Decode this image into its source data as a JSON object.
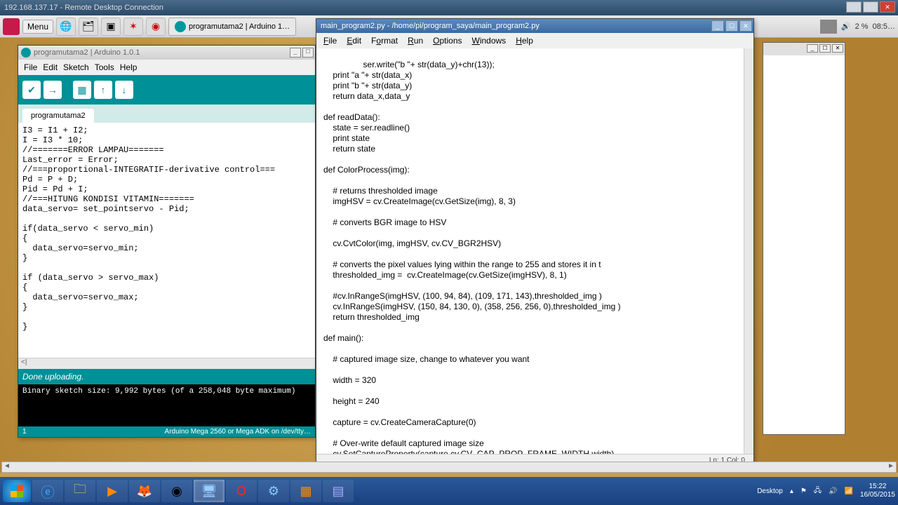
{
  "rdc": {
    "title": "192.168.137.17 - Remote Desktop Connection"
  },
  "rpi": {
    "menu_label": "Menu",
    "task1": "programutama2 | Arduino 1…",
    "tray_pct": "2 %",
    "tray_time": "08:5…"
  },
  "arduino": {
    "title": "programutama2 | Arduino 1.0.1",
    "menu": [
      "File",
      "Edit",
      "Sketch",
      "Tools",
      "Help"
    ],
    "tab": "programutama2",
    "code": "I3 = I1 + I2;\nI = I3 * 10;\n//=======ERROR LAMPAU=======\nLast_error = Error;\n//===proportional-INTEGRATIF-derivative control===\nPd = P + D;\nPid = Pd + I;\n//===HITUNG KONDISI VITAMIN=======\ndata_servo= set_pointservo - Pid;\n\nif(data_servo < servo_min)\n{\n  data_servo=servo_min;\n}\n\nif (data_servo > servo_max)\n{\n  data_servo=servo_max;\n}\n\n}",
    "scroll_hint": "<|",
    "status": "Done uploading.",
    "console": "Binary sketch size: 9,992 bytes (of a 258,048 byte maximum)",
    "foot_line": "1",
    "foot_board": "Arduino Mega 2560 or Mega ADK on /dev/tty…"
  },
  "idle": {
    "title": "main_program2.py - /home/pi/program_saya/main_program2.py",
    "menu": [
      "File",
      "Edit",
      "Format",
      "Run",
      "Options",
      "Windows",
      "Help"
    ],
    "code": "    ser.write(\"b \"+ str(data_y)+chr(13));\n    print \"a \"+ str(data_x)\n    print \"b \"+ str(data_y)\n    return data_x,data_y\n\ndef readData():\n    state = ser.readline()\n    print state\n    return state\n\ndef ColorProcess(img):\n\n    # returns thresholded image\n    imgHSV = cv.CreateImage(cv.GetSize(img), 8, 3)\n\n    # converts BGR image to HSV\n\n    cv.CvtColor(img, imgHSV, cv.CV_BGR2HSV)\n\n    # converts the pixel values lying within the range to 255 and stores it in t\n    thresholded_img =  cv.CreateImage(cv.GetSize(imgHSV), 8, 1)\n\n    #cv.InRangeS(imgHSV, (100, 94, 84), (109, 171, 143),thresholded_img )\n    cv.InRangeS(imgHSV, (150, 84, 130, 0), (358, 256, 256, 0),thresholded_img )\n    return thresholded_img\n\ndef main():\n\n    # captured image size, change to whatever you want\n\n    width = 320\n\n    height = 240\n\n    capture = cv.CreateCameraCapture(0)\n\n    # Over-write default captured image size\n    cv.SetCaptureProperty(capture,cv.CV_CAP_PROP_FRAME_WIDTH,width)\n    cv.SetCaptureProperty(capture,cv.CV_CAP_PROP_FRAME_HEIGHT,height)",
    "status": "Ln: 1 Col: 0"
  },
  "win": {
    "desktop_label": "Desktop",
    "time": "15:22",
    "date": "16/05/2015"
  }
}
